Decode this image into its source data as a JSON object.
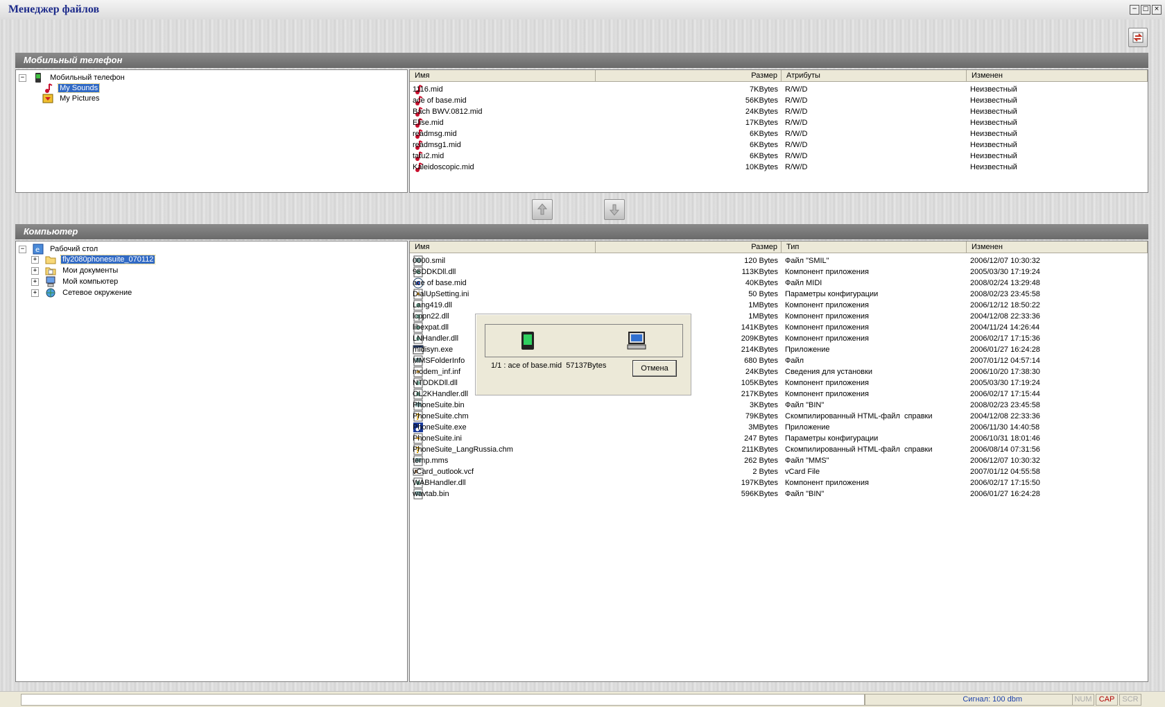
{
  "window": {
    "title": "Менеджер файлов",
    "buttons": [
      "−",
      "□",
      "×"
    ]
  },
  "phone_section": {
    "header": "Мобильный телефон",
    "tree": {
      "root": "Мобильный телефон",
      "children": [
        {
          "label": "My Sounds",
          "icon": "music-note-icon",
          "selected": true
        },
        {
          "label": "My Pictures",
          "icon": "picture-icon",
          "selected": false
        }
      ]
    },
    "columns": [
      "Имя",
      "Размер",
      "Атрибуты",
      "Изменен"
    ],
    "files": [
      {
        "name": "1116.mid",
        "size": "7KBytes",
        "attr": "R/W/D",
        "modified": "Неизвестный"
      },
      {
        "name": "ace of base.mid",
        "size": "56KBytes",
        "attr": "R/W/D",
        "modified": "Неизвестный"
      },
      {
        "name": "Bach BWV.0812.mid",
        "size": "24KBytes",
        "attr": "R/W/D",
        "modified": "Неизвестный"
      },
      {
        "name": "Elise.mid",
        "size": "17KBytes",
        "attr": "R/W/D",
        "modified": "Неизвестный"
      },
      {
        "name": "readmsg.mid",
        "size": "6KBytes",
        "attr": "R/W/D",
        "modified": "Неизвестный"
      },
      {
        "name": "readmsg1.mid",
        "size": "6KBytes",
        "attr": "R/W/D",
        "modified": "Неизвестный"
      },
      {
        "name": "tatu2.mid",
        "size": "6KBytes",
        "attr": "R/W/D",
        "modified": "Неизвестный"
      },
      {
        "name": "Kaleidoscopic.mid",
        "size": "10KBytes",
        "attr": "R/W/D",
        "modified": "Неизвестный"
      }
    ]
  },
  "transfer_buttons": [
    "upload-to-phone",
    "download-to-pc"
  ],
  "pc_section": {
    "header": "Компьютер",
    "tree": {
      "root": "Рабочий стол",
      "children": [
        {
          "label": "fly2080phonesuite_070112",
          "icon": "folder-icon",
          "selected": true
        },
        {
          "label": "Мои документы",
          "icon": "documents-folder-icon",
          "selected": false
        },
        {
          "label": "Мой компьютер",
          "icon": "computer-icon",
          "selected": false
        },
        {
          "label": "Сетевое окружение",
          "icon": "network-icon",
          "selected": false
        }
      ]
    },
    "columns": [
      "Имя",
      "Размер",
      "Тип",
      "Изменен"
    ],
    "files": [
      {
        "name": "0000.smil",
        "size": "120 Bytes",
        "type": "Файл \"SMIL\"",
        "modified": "2006/12/07 10:30:32",
        "icon": "generic"
      },
      {
        "name": "98DDKDll.dll",
        "size": "113KBytes",
        "type": "Компонент приложения",
        "modified": "2005/03/30 17:19:24",
        "icon": "dll"
      },
      {
        "name": "ace of base.mid",
        "size": "40KBytes",
        "type": "Файл MIDI",
        "modified": "2008/02/24 13:29:48",
        "icon": "midi"
      },
      {
        "name": "DialUpSetting.ini",
        "size": "50 Bytes",
        "type": "Параметры конфигурации",
        "modified": "2008/02/23 23:45:58",
        "icon": "ini"
      },
      {
        "name": "Lang419.dll",
        "size": "1MBytes",
        "type": "Компонент приложения",
        "modified": "2006/12/12 18:50:22",
        "icon": "dll"
      },
      {
        "name": "lcppn22.dll",
        "size": "1MBytes",
        "type": "Компонент приложения",
        "modified": "2004/12/08 22:33:36",
        "icon": "dll"
      },
      {
        "name": "libexpat.dll",
        "size": "141KBytes",
        "type": "Компонент приложения",
        "modified": "2004/11/24 14:26:44",
        "icon": "dll"
      },
      {
        "name": "LNHandler.dll",
        "size": "209KBytes",
        "type": "Компонент приложения",
        "modified": "2006/02/17 17:15:36",
        "icon": "dll"
      },
      {
        "name": "midisyn.exe",
        "size": "214KBytes",
        "type": "Приложение",
        "modified": "2006/01/27 16:24:28",
        "icon": "exe"
      },
      {
        "name": "MMSFolderInfo",
        "size": "680 Bytes",
        "type": "Файл",
        "modified": "2007/01/12 04:57:14",
        "icon": "generic"
      },
      {
        "name": "modem_inf.inf",
        "size": "24KBytes",
        "type": "Сведения для установки",
        "modified": "2006/10/20 17:38:30",
        "icon": "ini"
      },
      {
        "name": "NTDDKDll.dll",
        "size": "105KBytes",
        "type": "Компонент приложения",
        "modified": "2005/03/30 17:19:24",
        "icon": "dll"
      },
      {
        "name": "OL2KHandler.dll",
        "size": "217KBytes",
        "type": "Компонент приложения",
        "modified": "2006/02/17 17:15:44",
        "icon": "dll"
      },
      {
        "name": "PhoneSuite.bin",
        "size": "3KBytes",
        "type": "Файл \"BIN\"",
        "modified": "2008/02/23 23:45:58",
        "icon": "generic"
      },
      {
        "name": "PhoneSuite.chm",
        "size": "79KBytes",
        "type": "Скомпилированный HTML-файл  справки",
        "modified": "2004/12/08 22:33:36",
        "icon": "chm"
      },
      {
        "name": "PhoneSuite.exe",
        "size": "3MBytes",
        "type": "Приложение",
        "modified": "2006/11/30 14:40:58",
        "icon": "app"
      },
      {
        "name": "PhoneSuite.ini",
        "size": "247 Bytes",
        "type": "Параметры конфигурации",
        "modified": "2006/10/31 18:01:46",
        "icon": "ini"
      },
      {
        "name": "PhoneSuite_LangRussia.chm",
        "size": "211KBytes",
        "type": "Скомпилированный HTML-файл  справки",
        "modified": "2006/08/14 07:31:56",
        "icon": "chm"
      },
      {
        "name": "temp.mms",
        "size": "262 Bytes",
        "type": "Файл \"MMS\"",
        "modified": "2006/12/07 10:30:32",
        "icon": "generic"
      },
      {
        "name": "vCard_outlook.vcf",
        "size": "2 Bytes",
        "type": "vCard File",
        "modified": "2007/01/12 04:55:58",
        "icon": "vcf"
      },
      {
        "name": "WABHandler.dll",
        "size": "197KBytes",
        "type": "Компонент приложения",
        "modified": "2006/02/17 17:15:50",
        "icon": "dll"
      },
      {
        "name": "wavtab.bin",
        "size": "596KBytes",
        "type": "Файл \"BIN\"",
        "modified": "2006/01/27 16:24:28",
        "icon": "generic"
      }
    ]
  },
  "progress_dialog": {
    "status": "1/1 : ace of base.mid  57137Bytes",
    "cancel_label": "Отмена"
  },
  "statusbar": {
    "signal": "Сигнал: 100 dbm",
    "num": "NUM",
    "cap": "CAP",
    "scr": "SCR"
  },
  "colors": {
    "title_text": "#1c2a8a",
    "selection": "#316ac5",
    "music_icon": "#c8102e",
    "signal_text": "#1a3fa8",
    "cap_text": "#b00000"
  }
}
